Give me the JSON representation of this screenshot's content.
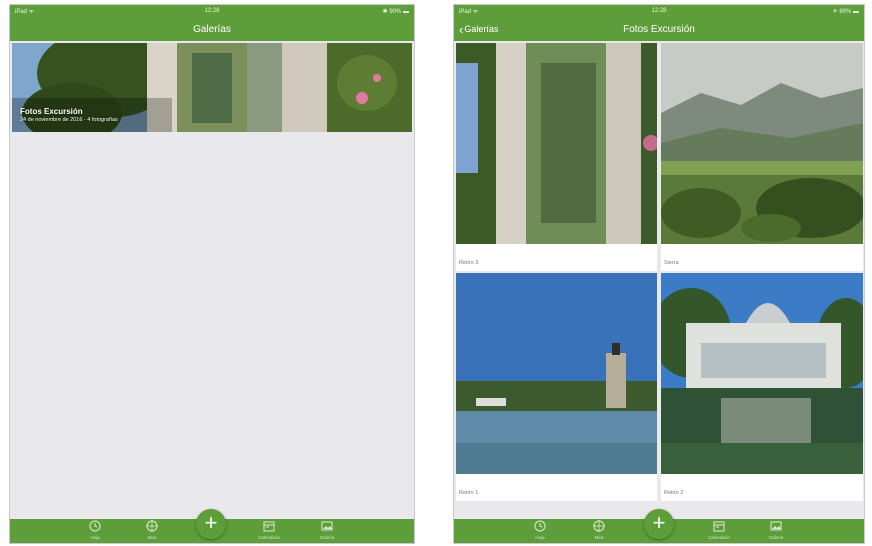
{
  "left_screen": {
    "status": {
      "carrier": "iPad ᯤ",
      "time": "12:28",
      "battery": "✱ 90% ▬"
    },
    "nav_title": "Galerías",
    "gallery": {
      "title": "Fotos Excursión",
      "subtitle": "24 de noviembre de 2016 · 4 fotografías"
    },
    "tabs": [
      {
        "label": "Hoja",
        "icon": "clock-icon"
      },
      {
        "label": "Mira",
        "icon": "target-icon"
      },
      {
        "label": "Calendario",
        "icon": "calendar-icon"
      },
      {
        "label": "Galería",
        "icon": "image-icon"
      }
    ],
    "fab_label": "+"
  },
  "right_screen": {
    "status": {
      "carrier": "iPad ᯤ",
      "time": "12:28",
      "battery": "✈ 89% ▬"
    },
    "back_label": "Galerías",
    "nav_title": "Fotos Excursión",
    "photos": [
      {
        "caption": "Retiro 3",
        "scene": "garden-pond"
      },
      {
        "caption": "Sierra",
        "scene": "mountains"
      },
      {
        "caption": "Retiro 1",
        "scene": "lake-monument"
      },
      {
        "caption": "Retiro 2",
        "scene": "crystal-palace"
      }
    ],
    "tabs": [
      {
        "label": "Hoja",
        "icon": "clock-icon"
      },
      {
        "label": "Mira",
        "icon": "target-icon"
      },
      {
        "label": "Calendario",
        "icon": "calendar-icon"
      },
      {
        "label": "Galería",
        "icon": "image-icon"
      }
    ],
    "fab_label": "+"
  },
  "colors": {
    "accent": "#5e9e3a",
    "background": "#e9e9ed"
  }
}
